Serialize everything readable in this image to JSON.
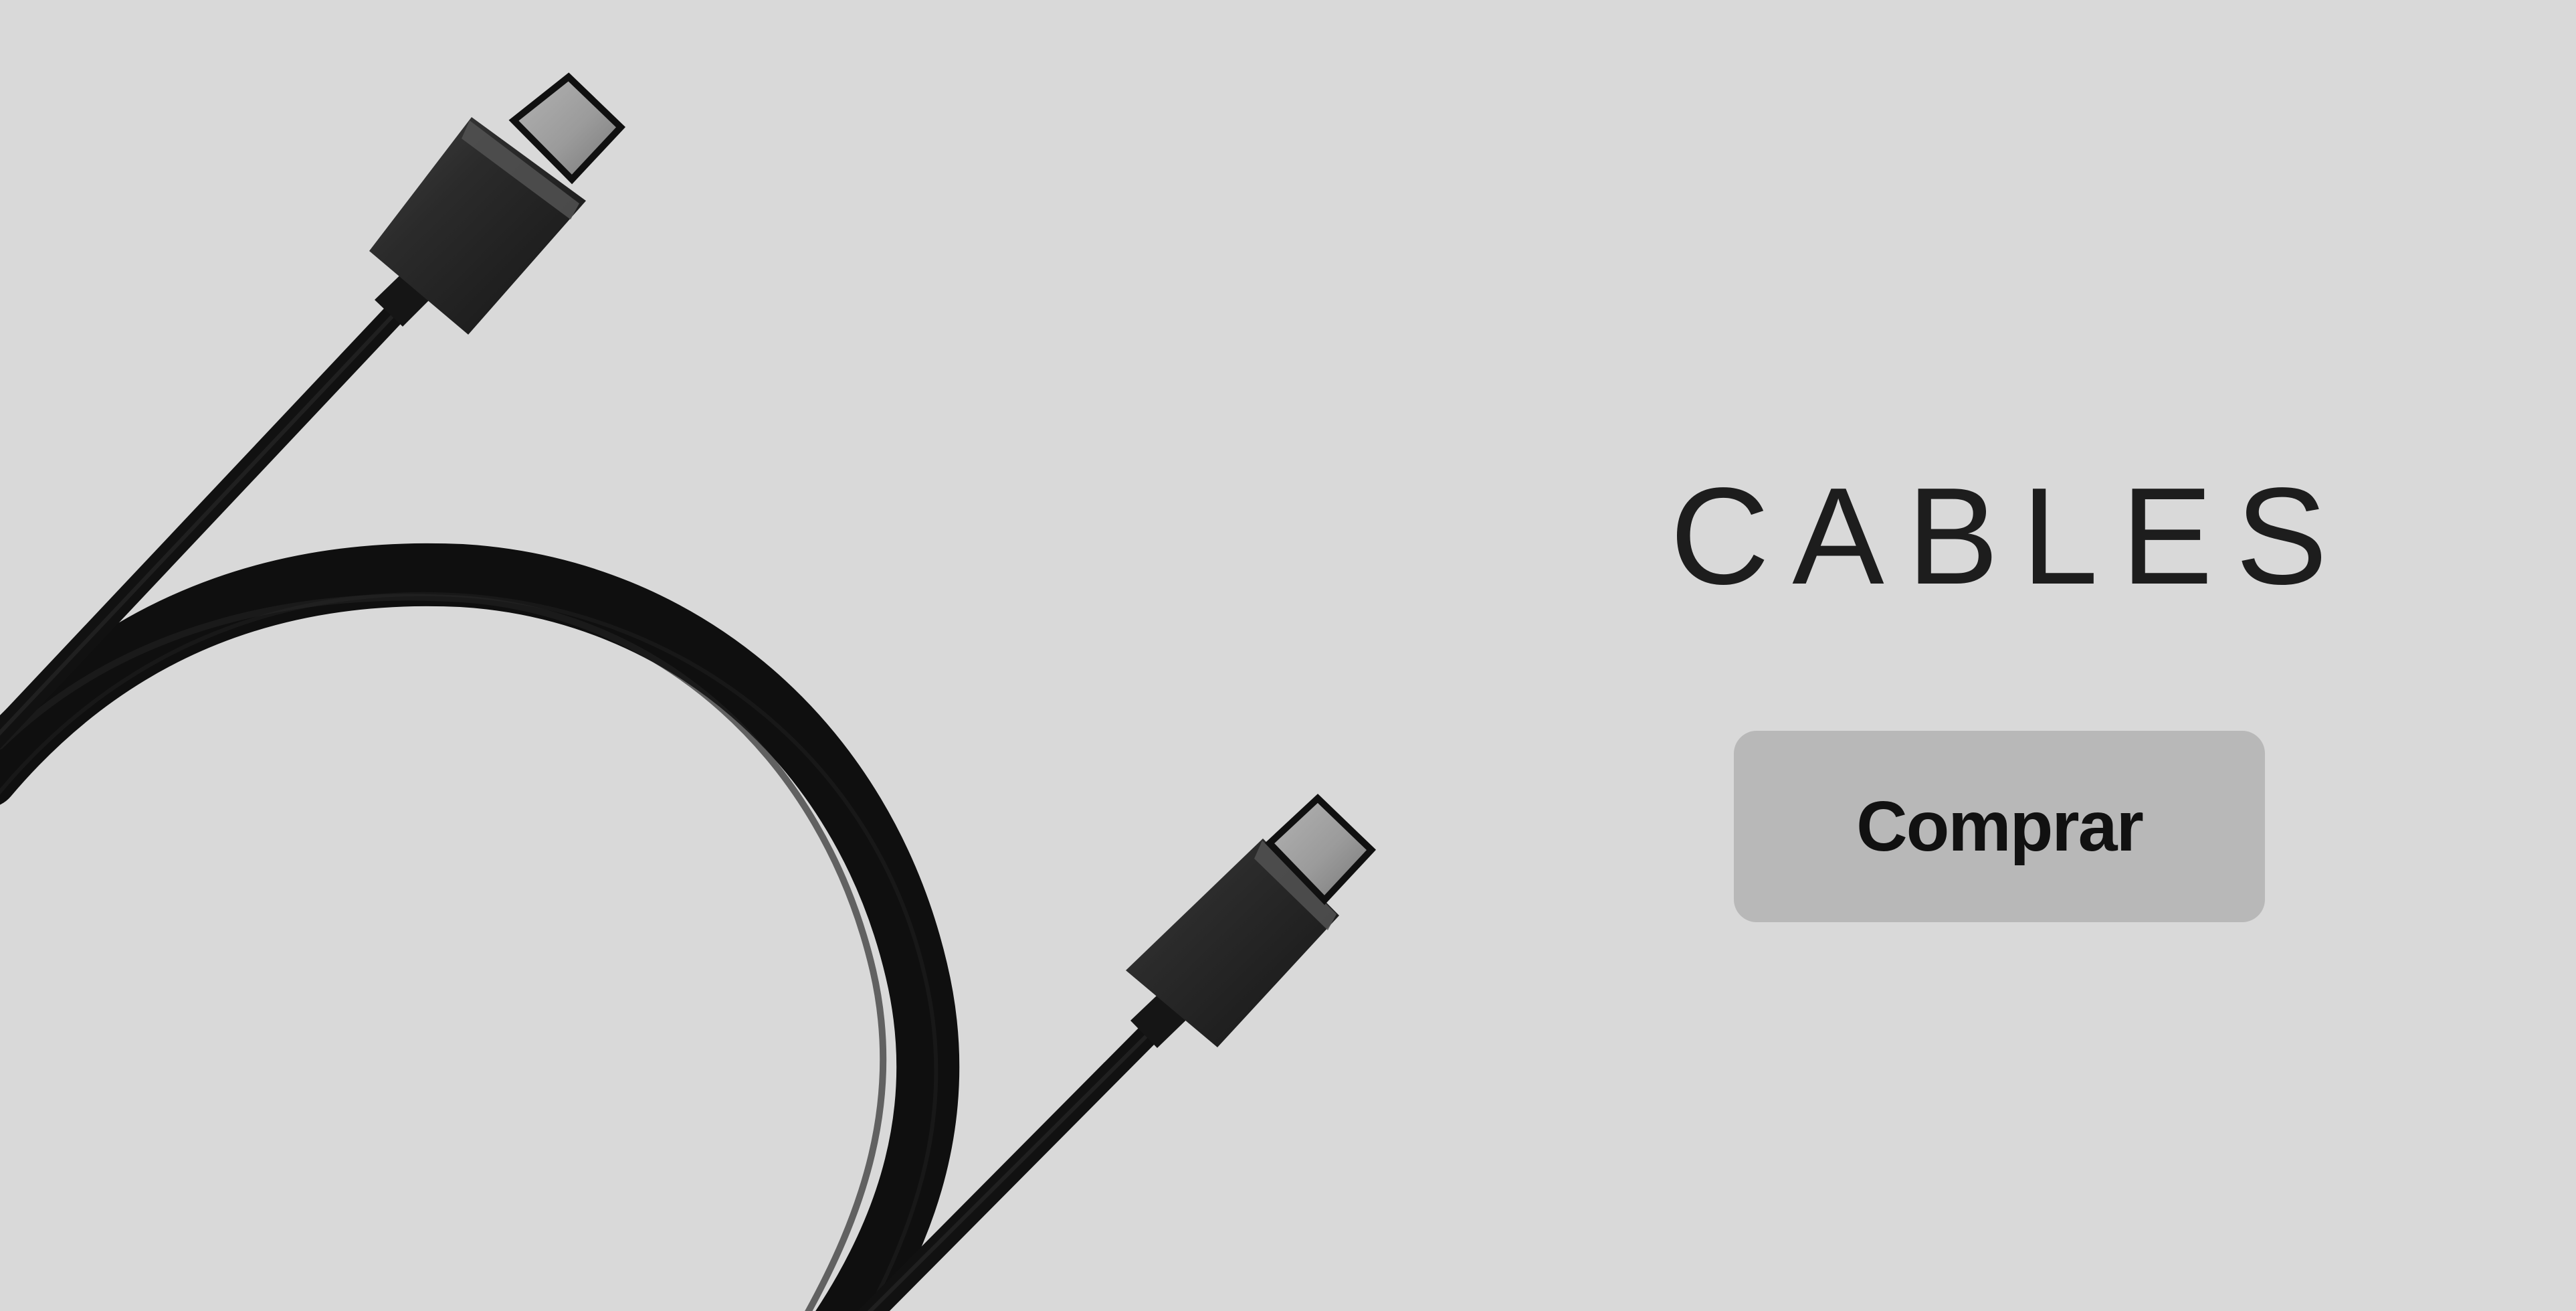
{
  "banner": {
    "title": "CABLES",
    "cta_label": "Comprar",
    "image_subject": "usb-c-cable-icon"
  },
  "colors": {
    "background": "#d9d9d9",
    "button": "#b8b8b8",
    "text": "#1d1d1d",
    "cable": "#111111",
    "connector": "#2a2a2a",
    "connector_tip": "#999999"
  }
}
